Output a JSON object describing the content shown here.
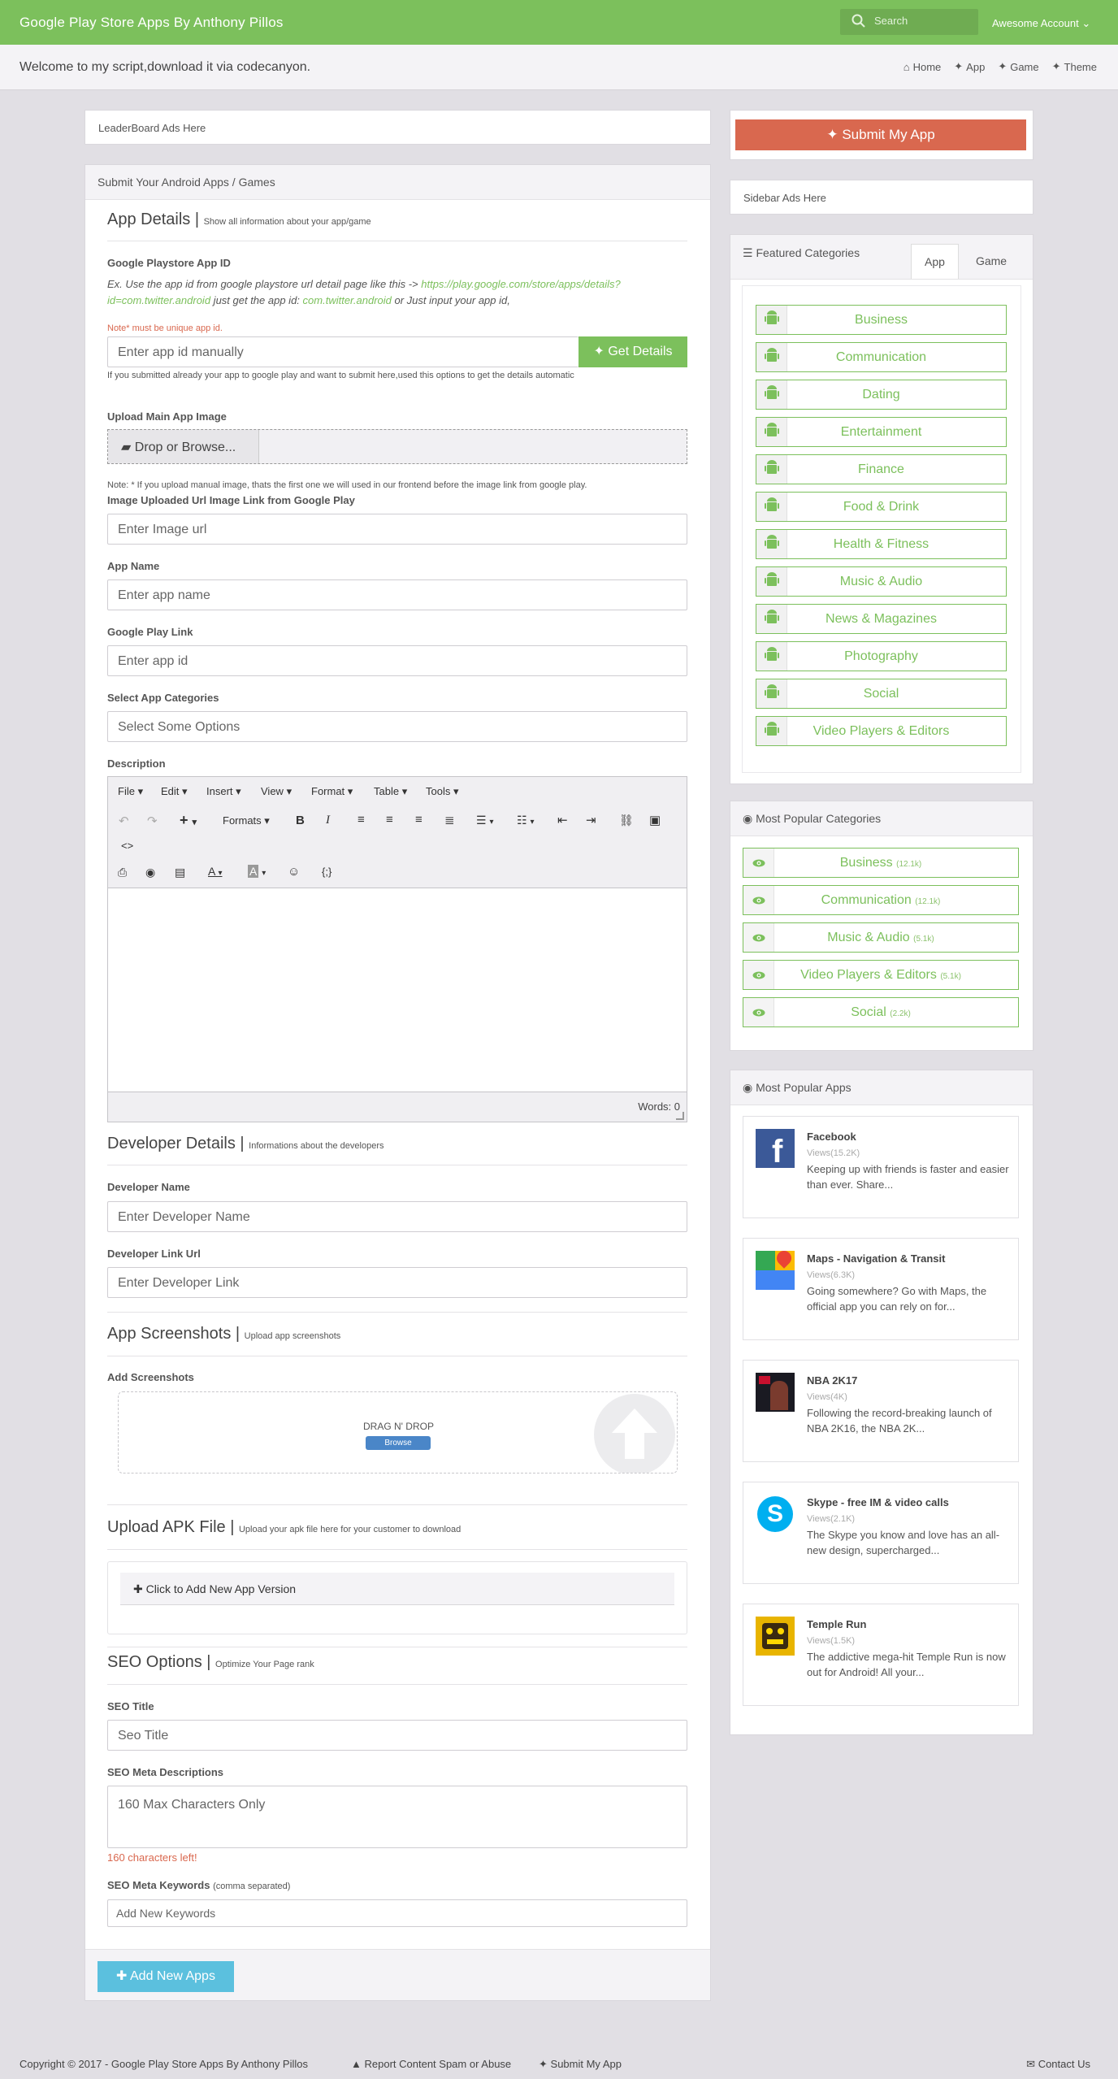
{
  "nav": {
    "brand": "Google Play Store Apps By Anthony Pillos",
    "search_placeholder": "Search",
    "account": "Awesome Account"
  },
  "subnav": {
    "welcome": "Welcome to my script,download it via codecanyon.",
    "links": [
      "Home",
      "App",
      "Game",
      "Theme"
    ]
  },
  "leaderboard": "LeaderBoard Ads Here",
  "form": {
    "panel_title": "Submit Your Android Apps / Games",
    "app_details_title": "App Details",
    "app_details_sub": "Show all information about your app/game",
    "playstore_id_label": "Google Playstore App ID",
    "playstore_hint_1": "Ex. Use the app id from google playstore url detail page like this -> ",
    "playstore_hint_url": "https://play.google.com/store/apps/details?id=com.twitter.android",
    "playstore_hint_2": " just get the app id: ",
    "playstore_hint_id": "com.twitter.android",
    "playstore_hint_3": " or Just input your app id,",
    "unique_note": "Note* must be unique app id.",
    "app_id_placeholder": "Enter app id manually",
    "get_details": "Get Details",
    "auto_note": "If you submitted already your app to google play and want to submit here,used this options to get the details automatic",
    "upload_image_label": "Upload Main App Image",
    "drop_browse": "Drop or Browse...",
    "manual_image_note": "Note: * If you upload manual image, thats the first one we will used in our frontend before the image link from google play.",
    "image_url_label": "Image Uploaded Url Image Link from Google Play",
    "image_url_placeholder": "Enter Image url",
    "app_name_label": "App Name",
    "app_name_placeholder": "Enter app name",
    "gp_link_label": "Google Play Link",
    "gp_link_placeholder": "Enter app id",
    "categories_label": "Select App Categories",
    "categories_placeholder": "Select Some Options",
    "description_label": "Description",
    "editor_menu": [
      "File",
      "Edit",
      "Insert",
      "View",
      "Format",
      "Table",
      "Tools"
    ],
    "editor_formats": "Formats",
    "editor_words": "Words: 0",
    "dev_title": "Developer Details",
    "dev_sub": "Informations about the developers",
    "dev_name_label": "Developer Name",
    "dev_name_placeholder": "Enter Developer Name",
    "dev_link_label": "Developer Link Url",
    "dev_link_placeholder": "Enter Developer Link",
    "shots_title": "App Screenshots",
    "shots_sub": "Upload app screenshots",
    "add_shots_label": "Add Screenshots",
    "drag_drop": "DRAG N' DROP",
    "browse": "Browse",
    "apk_title": "Upload APK File",
    "apk_sub": "Upload your apk file here for your customer to download",
    "add_version": "Click to Add New App Version",
    "seo_title": "SEO Options",
    "seo_sub": "Optimize Your Page rank",
    "seo_title_label": "SEO Title",
    "seo_title_placeholder": "Seo Title",
    "seo_meta_label": "SEO Meta Descriptions",
    "seo_meta_placeholder": "160 Max Characters Only",
    "chars_left": "160 characters left!",
    "seo_keywords_label": "SEO Meta Keywords",
    "seo_keywords_hint": "(comma separated)",
    "seo_keywords_placeholder": "Add New Keywords",
    "add_new_apps": "Add New Apps"
  },
  "sidebar": {
    "submit_button": "Submit My App",
    "ads": "Sidebar Ads Here",
    "featured_title": "Featured Categories",
    "tabs": [
      "App",
      "Game"
    ],
    "featured": [
      "Business",
      "Communication",
      "Dating",
      "Entertainment",
      "Finance",
      "Food & Drink",
      "Health & Fitness",
      "Music & Audio",
      "News & Magazines",
      "Photography",
      "Social",
      "Video Players & Editors"
    ],
    "popular_cat_title": "Most Popular Categories",
    "popular_categories": [
      {
        "name": "Business",
        "count": "(12.1k)"
      },
      {
        "name": "Communication",
        "count": "(12.1k)"
      },
      {
        "name": "Music & Audio",
        "count": "(5.1k)"
      },
      {
        "name": "Video Players & Editors",
        "count": "(5.1k)"
      },
      {
        "name": "Social",
        "count": "(2.2k)"
      }
    ],
    "popular_apps_title": "Most Popular Apps",
    "popular_apps": [
      {
        "name": "Facebook",
        "views": "Views(15.2K)",
        "desc": "Keeping up with friends is faster and easier than ever. Share..."
      },
      {
        "name": "Maps - Navigation & Transit",
        "views": "Views(6.3K)",
        "desc": "Going somewhere? Go with Maps, the official app you can rely on for..."
      },
      {
        "name": "NBA 2K17",
        "views": "Views(4K)",
        "desc": "Following the record-breaking launch of NBA 2K16, the NBA 2K..."
      },
      {
        "name": "Skype - free IM & video calls",
        "views": "Views(2.1K)",
        "desc": "The Skype you know and love has an all-new design, supercharged..."
      },
      {
        "name": "Temple Run",
        "views": "Views(1.5K)",
        "desc": "The addictive mega-hit Temple Run is now out for Android! All your..."
      }
    ]
  },
  "footer": {
    "copyright": "Copyright © 2017 - Google Play Store Apps By Anthony Pillos",
    "report": "Report Content Spam or Abuse",
    "submit": "Submit My App",
    "contact": "Contact Us"
  },
  "colors": {
    "green": "#7cc05c",
    "orange": "#d9684f",
    "blue": "#5bc0de"
  }
}
